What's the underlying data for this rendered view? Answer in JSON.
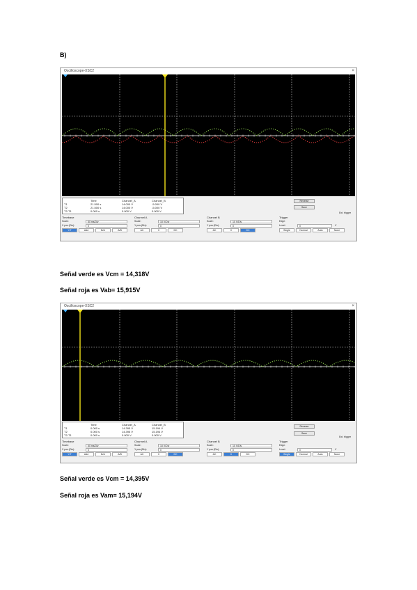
{
  "section_label": "B)",
  "scope_window_title": "Oscilloscope-XSC2",
  "close_glyph": "×",
  "figure1": {
    "readout": {
      "col_time": "Time",
      "col_ch_a": "Channel_A",
      "col_ch_b": "Channel_B",
      "rows": [
        {
          "label": "T1",
          "time": "21.500 s",
          "a": "14.000 V",
          "b": "-5.000 V"
        },
        {
          "label": "T2",
          "time": "21.500 s",
          "a": "14.000 V",
          "b": "-5.000 V"
        },
        {
          "label": "T2-T1",
          "time": "0.000 s",
          "a": "0.000 V",
          "b": "0.000 V"
        }
      ]
    },
    "reverse_label": "Reverse",
    "save_label": "Save",
    "ext_trigger_label": "Ext. trigger",
    "timebase": {
      "title": "Timebase",
      "scale_label": "Scale:",
      "scale": "50 ms/Div",
      "pos_label": "X pos.(Div):",
      "pos": "0",
      "buttons": [
        "Y/T",
        "Add",
        "B/A",
        "A/B"
      ]
    },
    "channel_a": {
      "title": "Channel A",
      "scale_label": "Scale:",
      "scale": "10 V/Div",
      "pos_label": "Y pos.(Div):",
      "pos": "0",
      "buttons": [
        "AC",
        "0",
        "DC"
      ]
    },
    "channel_b": {
      "title": "Channel B",
      "scale_label": "Scale:",
      "scale": "10 V/Div",
      "pos_label": "Y pos.(Div):",
      "pos": "0",
      "buttons": [
        "AC",
        "0",
        "DC"
      ]
    },
    "trigger": {
      "title": "Trigger",
      "edge_label": "Edge:",
      "level_label": "Level:",
      "level": "0",
      "unit": "V",
      "buttons": [
        "Single",
        "Normal",
        "Auto",
        "None"
      ]
    }
  },
  "caption1a": "Señal verde es Vcm = 14,318V",
  "caption1b": "Señal roja es Vab= 15,915V",
  "figure2": {
    "readout": {
      "col_time": "Time",
      "col_ch_a": "Channel_A",
      "col_ch_b": "Channel_B",
      "rows": [
        {
          "label": "T1",
          "time": "0.000 s",
          "a": "14.395 V",
          "b": "15.194 V"
        },
        {
          "label": "T2",
          "time": "0.000 s",
          "a": "14.395 V",
          "b": "15.194 V"
        },
        {
          "label": "T2-T1",
          "time": "0.000 s",
          "a": "0.000 V",
          "b": "0.000 V"
        }
      ]
    },
    "reverse_label": "Reverse",
    "save_label": "Save",
    "ext_trigger_label": "Ext. trigger",
    "timebase": {
      "title": "Timebase",
      "scale_label": "Scale:",
      "scale": "50 ms/Div",
      "pos_label": "X pos.(Div):",
      "pos": "0",
      "buttons": [
        "Y/T",
        "Add",
        "B/A",
        "A/B"
      ]
    },
    "channel_a": {
      "title": "Channel A",
      "scale_label": "Scale:",
      "scale": "10 V/Div",
      "pos_label": "Y pos.(Div):",
      "pos": "0",
      "buttons": [
        "AC",
        "0",
        "DC"
      ]
    },
    "channel_b": {
      "title": "Channel B",
      "scale_label": "Scale:",
      "scale": "10 V/Div",
      "pos_label": "Y pos.(Div):",
      "pos": "0",
      "buttons": [
        "AC",
        "0",
        "DC"
      ]
    },
    "trigger": {
      "title": "Trigger",
      "edge_label": "Edge:",
      "level_label": "Level:",
      "level": "0",
      "unit": "V",
      "buttons": [
        "Single",
        "Normal",
        "Auto",
        "None"
      ]
    }
  },
  "caption2a": "Señal verde es Vcm = 14,395V",
  "caption2b": "Señal roja es Vam= 15,194V",
  "colors": {
    "screen": "#000000",
    "green_trace": "#8fd14f",
    "red_trace": "#e03c3c",
    "cursor": "#f2e21a",
    "grid": "#e6e6e6"
  }
}
